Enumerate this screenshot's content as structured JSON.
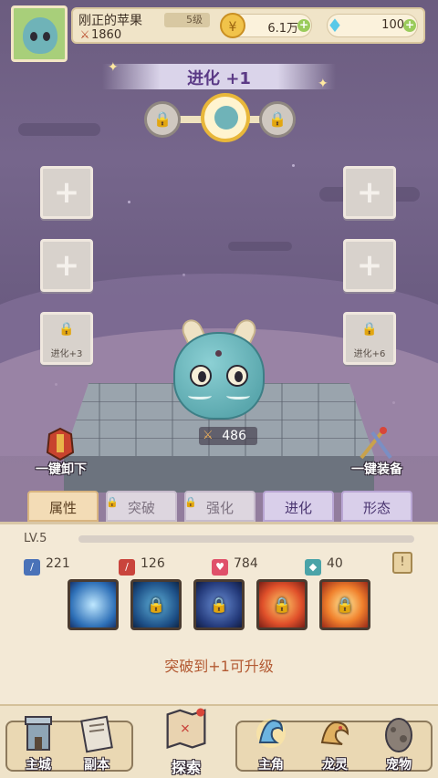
{
  "player": {
    "name": "刚正的苹果",
    "level": "5级",
    "power": "1860",
    "coins": "6.1万",
    "gems": "100"
  },
  "evolution": {
    "title": "进化 +1"
  },
  "slots": {
    "left_locked_label": "进化+3",
    "right_locked_label": "进化+6"
  },
  "creature": {
    "power": "486"
  },
  "actions": {
    "unequip_all": "一键卸下",
    "equip_all": "一键装备"
  },
  "tabs": [
    {
      "label": "属性",
      "state": "active"
    },
    {
      "label": "突破",
      "state": "locked"
    },
    {
      "label": "强化",
      "state": "locked"
    },
    {
      "label": "进化",
      "state": "selected"
    },
    {
      "label": "形态",
      "state": "locked"
    }
  ],
  "panel": {
    "level": "LV.5",
    "level_progress": 0,
    "stats": {
      "attack": "221",
      "crit": "126",
      "hp": "784",
      "defense": "40"
    },
    "info_icon": "scroll-icon",
    "upgrade_hint": "突破到+1可升级"
  },
  "skills": [
    {
      "name": "ice-crystal-skill",
      "locked": false
    },
    {
      "name": "water-dragon-skill",
      "locked": true
    },
    {
      "name": "storm-dragon-skill",
      "locked": true
    },
    {
      "name": "fire-vortex-skill",
      "locked": true
    },
    {
      "name": "flame-burst-skill",
      "locked": true
    }
  ],
  "nav": {
    "main_city": "主城",
    "dungeon": "副本",
    "explore": "探索",
    "hero": "主角",
    "dragon_spirit": "龙灵",
    "pet": "宠物"
  },
  "colors": {
    "accent": "#e8b73a",
    "upgrade_text": "#b35a33",
    "panel_bg": "#f3e9d6"
  }
}
